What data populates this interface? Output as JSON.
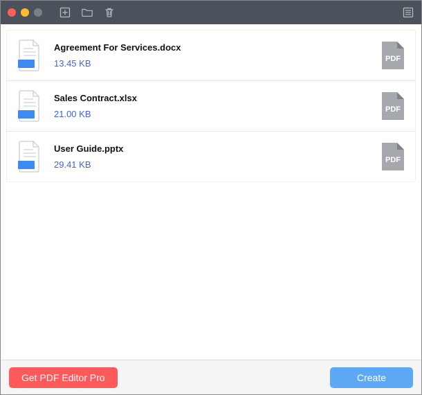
{
  "toolbar": {
    "icons": {
      "add": "add-file-icon",
      "folder": "folder-icon",
      "trash": "trash-icon",
      "list": "list-icon"
    }
  },
  "files": [
    {
      "name": "Agreement For Services.docx",
      "size": "13.45 KB"
    },
    {
      "name": "Sales Contract.xlsx",
      "size": "21.00 KB"
    },
    {
      "name": "User Guide.pptx",
      "size": "29.41 KB"
    }
  ],
  "pdf_badge_label": "PDF",
  "footer": {
    "promo_label": "Get PDF Editor Pro",
    "create_label": "Create"
  }
}
